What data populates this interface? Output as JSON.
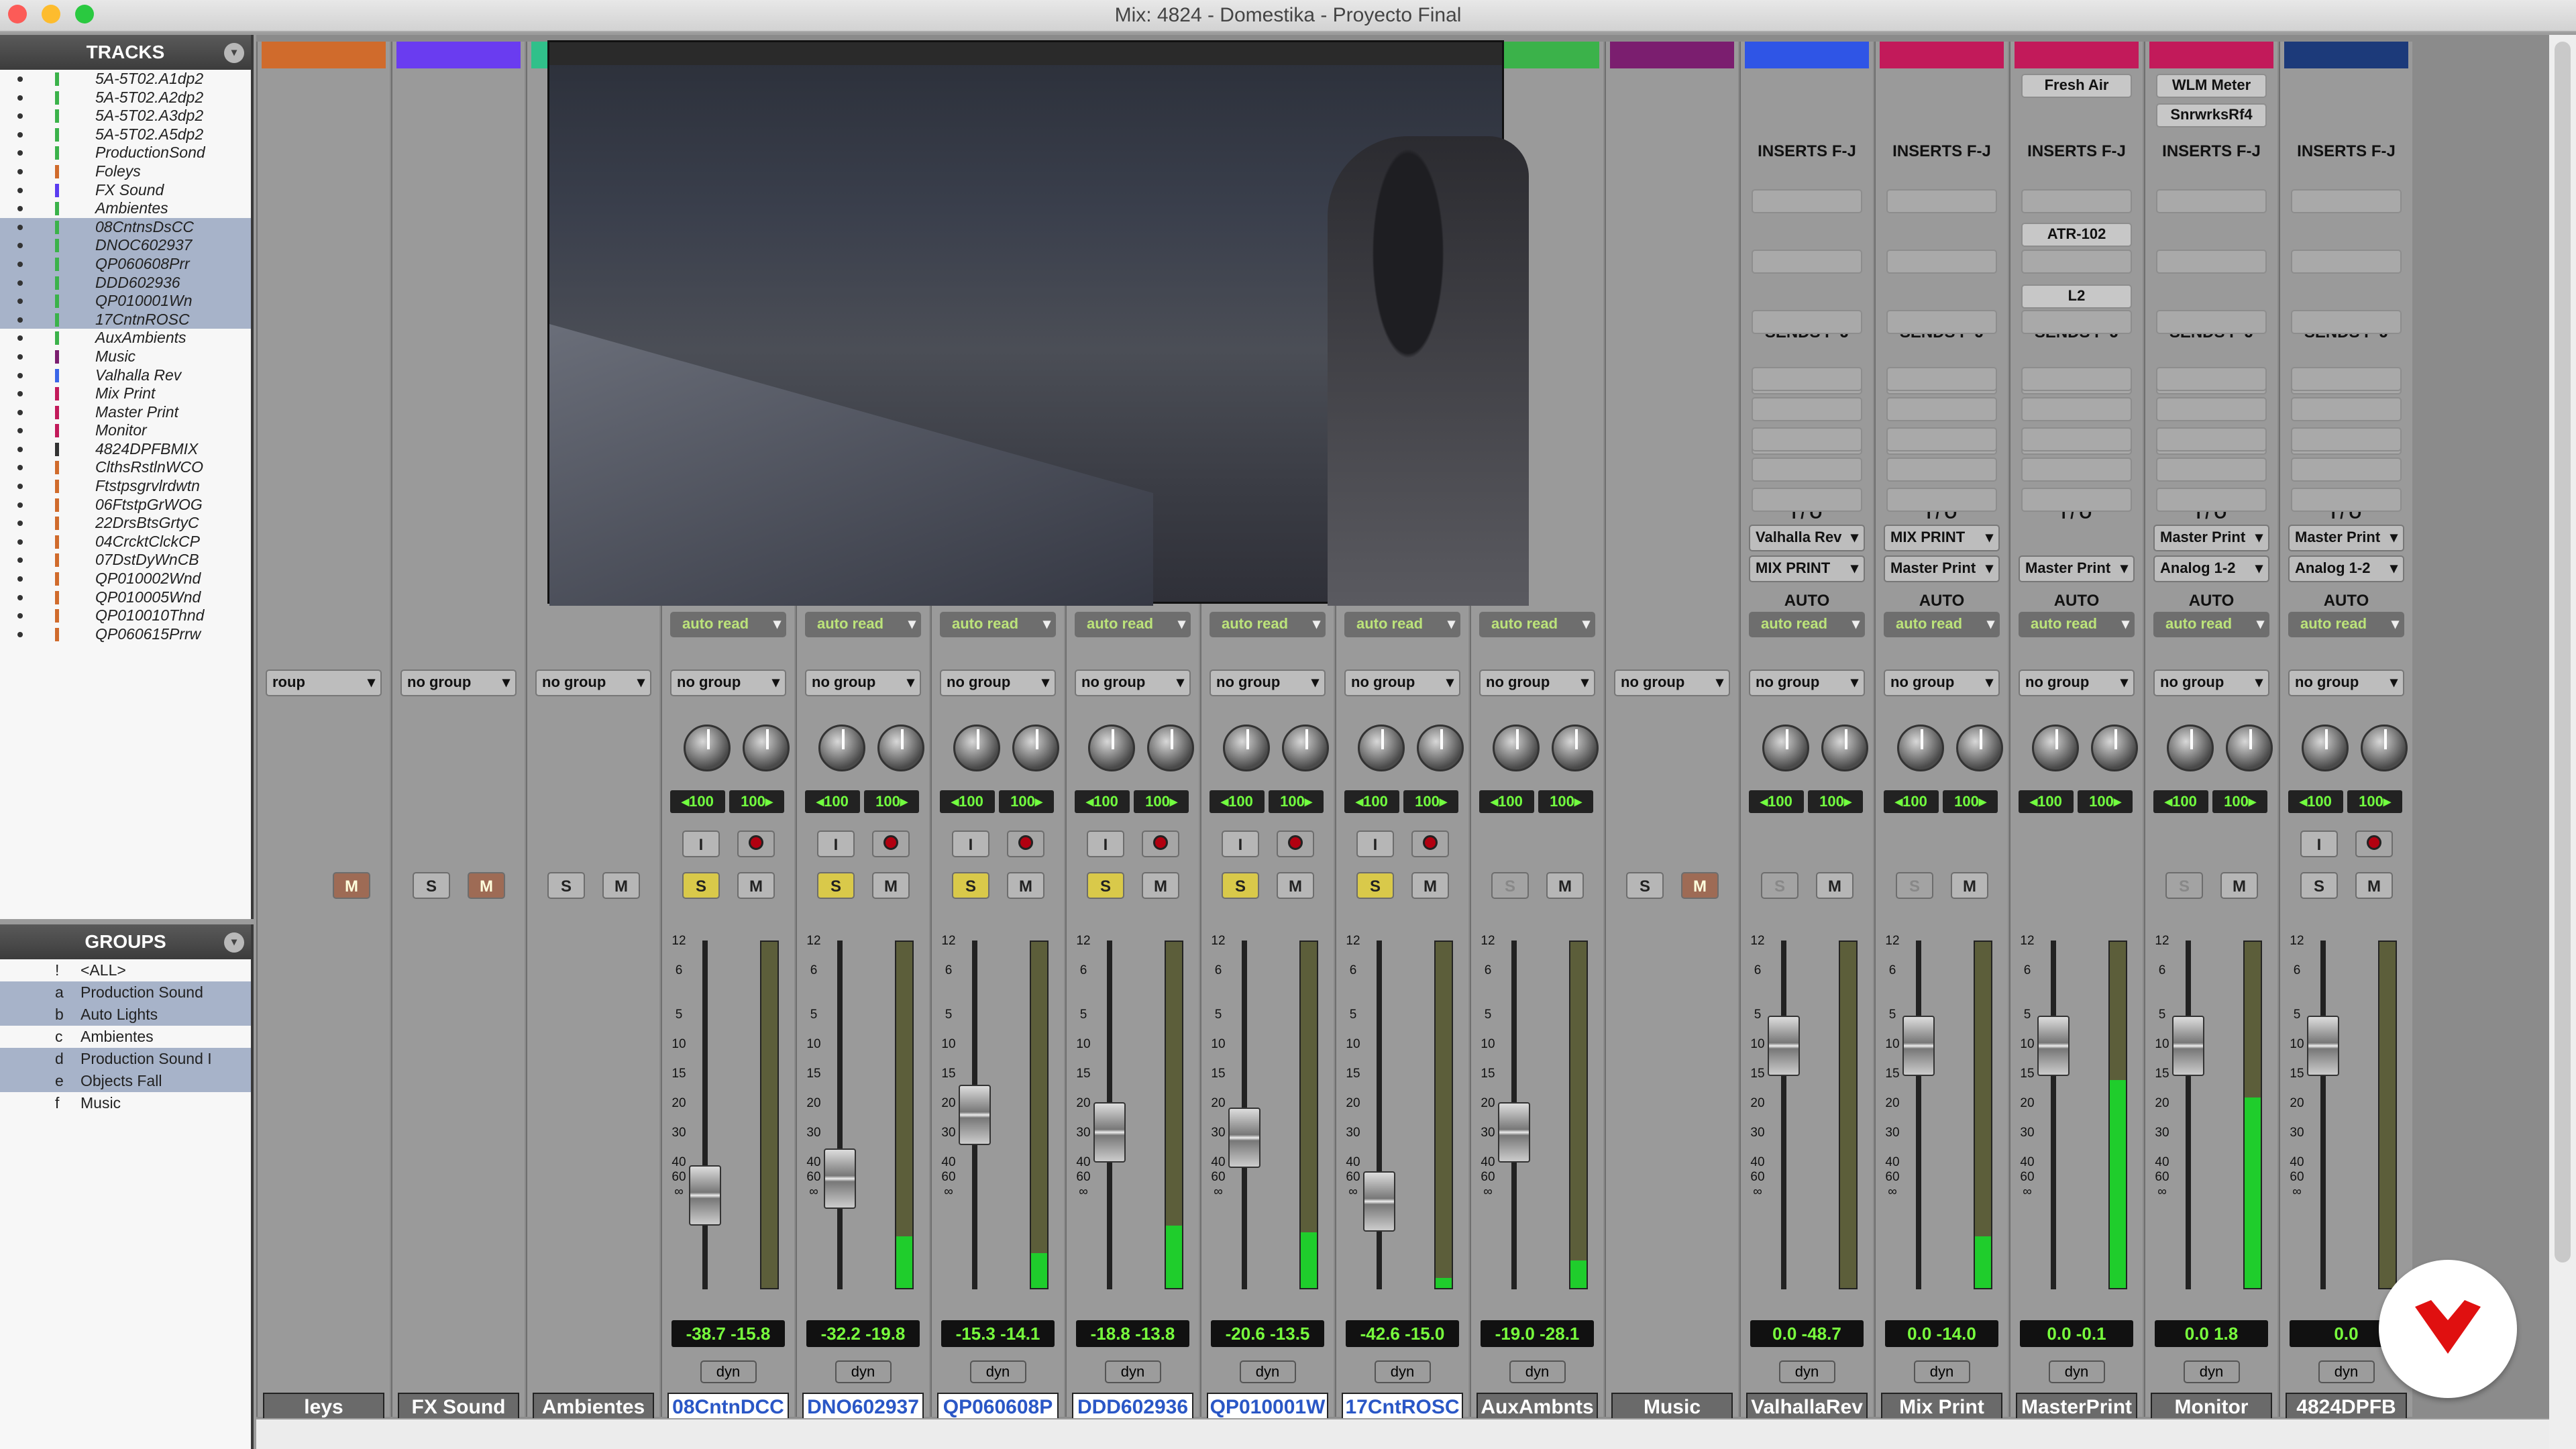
{
  "window": {
    "title": "Mix: 4824 - Domestika - Proyecto Final"
  },
  "tracks_panel": {
    "title": "TRACKS",
    "items": [
      {
        "name": "5A-5T02.A1dp2",
        "color": "#3bb24a",
        "sel": false
      },
      {
        "name": "5A-5T02.A2dp2",
        "color": "#3bb24a",
        "sel": false
      },
      {
        "name": "5A-5T02.A3dp2",
        "color": "#3bb24a",
        "sel": false
      },
      {
        "name": "5A-5T02.A5dp2",
        "color": "#3bb24a",
        "sel": false
      },
      {
        "name": "ProductionSond",
        "color": "#3bb24a",
        "sel": false
      },
      {
        "name": "Foleys",
        "color": "#d06b2c",
        "sel": false
      },
      {
        "name": "FX Sound",
        "color": "#5a3cf0",
        "sel": false
      },
      {
        "name": "Ambientes",
        "color": "#3bb24a",
        "sel": false
      },
      {
        "name": "08CntnsDsCC",
        "color": "#3bb24a",
        "sel": true
      },
      {
        "name": "DNOC602937",
        "color": "#3bb24a",
        "sel": true
      },
      {
        "name": "QP060608Prr",
        "color": "#3bb24a",
        "sel": true
      },
      {
        "name": "DDD602936",
        "color": "#3bb24a",
        "sel": true
      },
      {
        "name": "QP010001Wn",
        "color": "#3bb24a",
        "sel": true
      },
      {
        "name": "17CntnROSC",
        "color": "#3bb24a",
        "sel": true
      },
      {
        "name": "AuxAmbients",
        "color": "#3bb24a",
        "sel": false
      },
      {
        "name": "Music",
        "color": "#7b1e6f",
        "sel": false
      },
      {
        "name": "Valhalla Rev",
        "color": "#3a66e8",
        "sel": false
      },
      {
        "name": "Mix Print",
        "color": "#c21a5a",
        "sel": false
      },
      {
        "name": "Master Print",
        "color": "#c21a5a",
        "sel": false
      },
      {
        "name": "Monitor",
        "color": "#c21a5a",
        "sel": false
      },
      {
        "name": "4824DPFBMIX",
        "color": "#333",
        "sel": false
      },
      {
        "name": "ClthsRstlnWCO",
        "color": "#d06b2c",
        "sel": false
      },
      {
        "name": "Ftstpsgrvlrdwtn",
        "color": "#d06b2c",
        "sel": false
      },
      {
        "name": "06FtstpGrWOG",
        "color": "#d06b2c",
        "sel": false
      },
      {
        "name": "22DrsBtsGrtyC",
        "color": "#d06b2c",
        "sel": false
      },
      {
        "name": "04CrcktClckCP",
        "color": "#d06b2c",
        "sel": false
      },
      {
        "name": "07DstDyWnCB",
        "color": "#d06b2c",
        "sel": false
      },
      {
        "name": "QP010002Wnd",
        "color": "#d06b2c",
        "sel": false
      },
      {
        "name": "QP010005Wnd",
        "color": "#d06b2c",
        "sel": false
      },
      {
        "name": "QP010010Thnd",
        "color": "#d06b2c",
        "sel": false
      },
      {
        "name": "QP060615Prrw",
        "color": "#d06b2c",
        "sel": false
      }
    ]
  },
  "groups_panel": {
    "title": "GROUPS",
    "items": [
      {
        "id": "!",
        "name": "<ALL>",
        "sel": false
      },
      {
        "id": "a",
        "name": "Production Sound",
        "sel": true
      },
      {
        "id": "b",
        "name": "Auto Lights",
        "sel": true
      },
      {
        "id": "c",
        "name": "Ambientes",
        "sel": false
      },
      {
        "id": "d",
        "name": "Production Sound I",
        "sel": true
      },
      {
        "id": "e",
        "name": "Objects Fall",
        "sel": true
      },
      {
        "id": "f",
        "name": "Music",
        "sel": false
      }
    ]
  },
  "mixer": {
    "labels": {
      "inserts": "INSERTS F-J",
      "sends": "SENDS F-J",
      "io": "I / O",
      "auto": "AUTO",
      "pan_l": "◂100",
      "pan_r": "100▸",
      "dyn": "dyn"
    },
    "strips": [
      {
        "name": "leys",
        "color": "#d06b2c",
        "group": "roup",
        "vol": "",
        "panv": "",
        "solo": "",
        "mute": "M",
        "ms": true,
        "fader": 0.78,
        "meter": 0,
        "hl": false
      },
      {
        "name": "FX Sound",
        "color": "#6a3cf0",
        "group": "no group",
        "vol": "",
        "panv": "",
        "solo": "S",
        "mute": "M",
        "ms": true,
        "fader": 0.78,
        "meter": 0,
        "hl": false
      },
      {
        "name": "Ambientes",
        "color": "#30c08a",
        "group": "no group",
        "vol": "",
        "panv": "",
        "solo": "S",
        "mute": "M",
        "ms": false,
        "fader": 0.78,
        "meter": 0,
        "hl": false
      },
      {
        "name": "08CntnDCC",
        "color": "#3bb24a",
        "group": "no group",
        "auto": "auto read",
        "vol": "-38.7",
        "panv": "-15.8",
        "solo": "S",
        "mute": "M",
        "son": true,
        "fader": 0.78,
        "meter": 0,
        "hl": true,
        "rec": true
      },
      {
        "name": "DNO602937",
        "color": "#3bb24a",
        "group": "no group",
        "auto": "auto read",
        "vol": "-32.2",
        "panv": "-19.8",
        "solo": "S",
        "mute": "M",
        "son": true,
        "fader": 0.72,
        "meter": 0.15,
        "hl": true,
        "rec": true
      },
      {
        "name": "QP060608P",
        "color": "#3bb24a",
        "group": "no group",
        "auto": "auto read",
        "vol": "-15.3",
        "panv": "-14.1",
        "solo": "S",
        "mute": "M",
        "son": true,
        "fader": 0.5,
        "meter": 0.1,
        "hl": true,
        "rec": true
      },
      {
        "name": "DDD602936",
        "color": "#3bb24a",
        "group": "no group",
        "auto": "auto read",
        "vol": "-18.8",
        "panv": "-13.8",
        "solo": "S",
        "mute": "M",
        "son": true,
        "fader": 0.56,
        "meter": 0.18,
        "hl": true,
        "rec": true
      },
      {
        "name": "QP010001W",
        "color": "#3bb24a",
        "group": "no group",
        "auto": "auto read",
        "vol": "-20.6",
        "panv": "-13.5",
        "solo": "S",
        "mute": "M",
        "son": true,
        "fader": 0.58,
        "meter": 0.16,
        "hl": true,
        "rec": true
      },
      {
        "name": "17CntROSC",
        "color": "#3bb24a",
        "group": "no group",
        "auto": "auto read",
        "vol": "-42.6",
        "panv": "-15.0",
        "solo": "S",
        "mute": "M",
        "son": true,
        "fader": 0.8,
        "meter": 0.03,
        "hl": true,
        "rec": true
      },
      {
        "name": "AuxAmbnts",
        "color": "#3bb24a",
        "group": "no group",
        "auto": "auto read",
        "vol": "-19.0",
        "panv": "-28.1",
        "solo": "S",
        "mute": "M",
        "son": false,
        "fader": 0.56,
        "meter": 0.08,
        "hl": false,
        "rec": false
      },
      {
        "name": "Music",
        "color": "#7b1e6f",
        "group": "no group",
        "vol": "",
        "panv": "",
        "solo": "S",
        "mute": "M",
        "ms": true,
        "fader": 0.78,
        "meter": 0,
        "hl": false
      },
      {
        "name": "ValhallaRev",
        "color": "#2f55e6",
        "group": "no group",
        "auto": "auto read",
        "io1": "Valhalla Rev",
        "io2": "MIX PRINT",
        "vol": "0.0",
        "panv": "-48.7",
        "solo": "S",
        "mute": "M",
        "son": false,
        "fader": 0.26,
        "meter": 0,
        "hl": false,
        "rec": false
      },
      {
        "name": "Mix Print",
        "color": "#c21a5a",
        "group": "no group",
        "auto": "auto read",
        "io1": "MIX PRINT",
        "io2": "Master Print",
        "vol": "0.0",
        "panv": "-14.0",
        "solo": "S",
        "mute": "M",
        "son": false,
        "fader": 0.26,
        "meter": 0.15,
        "hl": false,
        "rec": false
      },
      {
        "name": "MasterPrint",
        "color": "#c21a5a",
        "group": "no group",
        "auto": "auto read",
        "io1": "",
        "io2": "Master Print",
        "ins1": "Fresh Air",
        "ins2": "ATR-102",
        "ins3": "L2",
        "vol": "0.0",
        "panv": "-0.1",
        "solo": "",
        "mute": "",
        "fader": 0.26,
        "meter": 0.6,
        "hl": false,
        "rec": false
      },
      {
        "name": "Monitor",
        "color": "#c21a5a",
        "group": "no group",
        "auto": "auto read",
        "io1": "Master Print",
        "io2": "Analog 1-2",
        "ins1": "WLM Meter",
        "ins2": "SnrwrksRf4",
        "vol": "0.0",
        "panv": "1.8",
        "solo": "S",
        "mute": "M",
        "son": false,
        "fader": 0.26,
        "meter": 0.55,
        "hl": false,
        "rec": false
      },
      {
        "name": "4824DPFB",
        "color": "#1c3a7a",
        "group": "no group",
        "auto": "auto read",
        "io1": "Master Print",
        "io2": "Analog 1-2",
        "vol": "0.0",
        "panv": "",
        "solo": "S",
        "mute": "M",
        "son": false,
        "fader": 0.26,
        "meter": 0,
        "hl": false,
        "rec": true
      }
    ]
  }
}
